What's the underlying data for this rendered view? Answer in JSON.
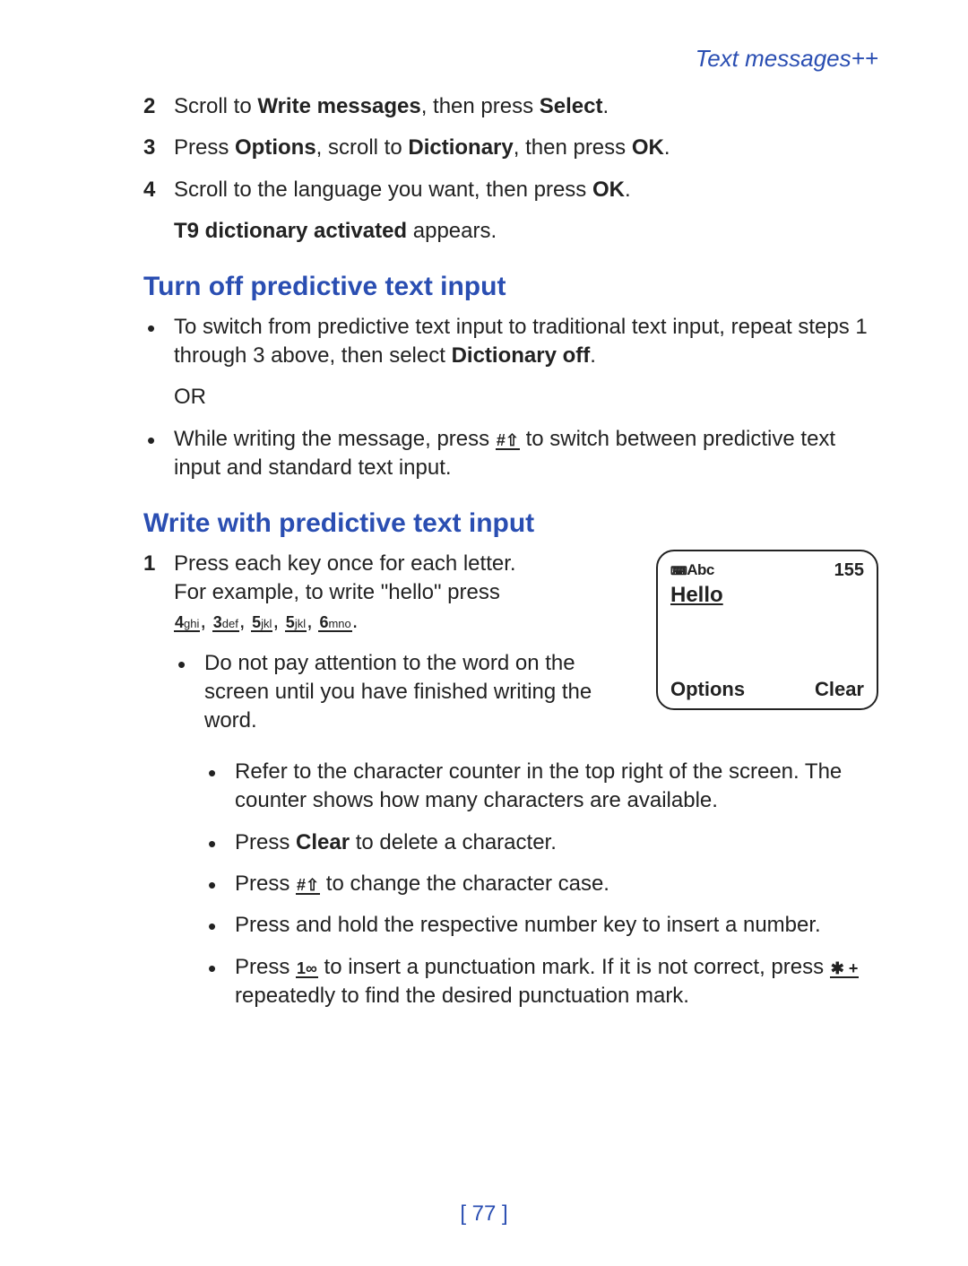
{
  "header": "Text messages++",
  "steps": {
    "s2": {
      "n": "2",
      "pre": "Scroll to ",
      "b1": "Write messages",
      "mid": ", then press ",
      "b2": "Select",
      "post": "."
    },
    "s3": {
      "n": "3",
      "pre": "Press ",
      "b1": "Options",
      "mid1": ", scroll to ",
      "b2": "Dictionary",
      "mid2": ", then press ",
      "b3": "OK",
      "post": "."
    },
    "s4": {
      "n": "4",
      "pre": "Scroll to the language you want, then press ",
      "b1": "OK",
      "post": "."
    },
    "s4_after": {
      "b": "T9 dictionary activated",
      "post": " appears."
    }
  },
  "section1": {
    "title": "Turn off predictive text input",
    "b1_pre": "To switch from predictive text input to traditional text input, repeat steps 1 through 3 above, then select ",
    "b1_bold": "Dictionary off",
    "b1_post": ".",
    "or": "OR",
    "b2_pre": "While writing the message, press ",
    "b2_post": " to switch between predictive text input and standard text input."
  },
  "section2": {
    "title": "Write with predictive text input",
    "step1": {
      "n": "1",
      "line1": "Press each key once for each letter.",
      "line2": "For example, to write \"hello\" press"
    },
    "keys": {
      "k4": "4",
      "k4s": "ghi",
      "k3": "3",
      "k3s": "def",
      "k5": "5",
      "k5s": "jkl",
      "k5b": "5",
      "k5bs": "jkl",
      "k6": "6",
      "k6s": "mno"
    },
    "sub1": "Do not pay attention to the word on the screen until you have finished writing the word.",
    "sub2": "Refer to the character counter in the top right of the screen. The counter shows how many characters are available.",
    "sub3_pre": "Press ",
    "sub3_b": "Clear",
    "sub3_post": " to delete a character.",
    "sub4_pre": "Press ",
    "sub4_post": " to change the character case.",
    "sub5": "Press and hold the respective number key to insert a number.",
    "sub6_pre": "Press ",
    "sub6_mid": " to insert a punctuation mark. If it is not correct, press ",
    "sub6_post": " repeatedly to find the desired punctuation mark."
  },
  "key_hash": "#⇧",
  "key_one": "1∞",
  "key_star": "✱ +",
  "phone": {
    "mode_prefix": "⌨",
    "mode": "Abc",
    "count": "155",
    "word": "Hello",
    "soft_left": "Options",
    "soft_right": "Clear"
  },
  "page_number": "[ 77 ]"
}
